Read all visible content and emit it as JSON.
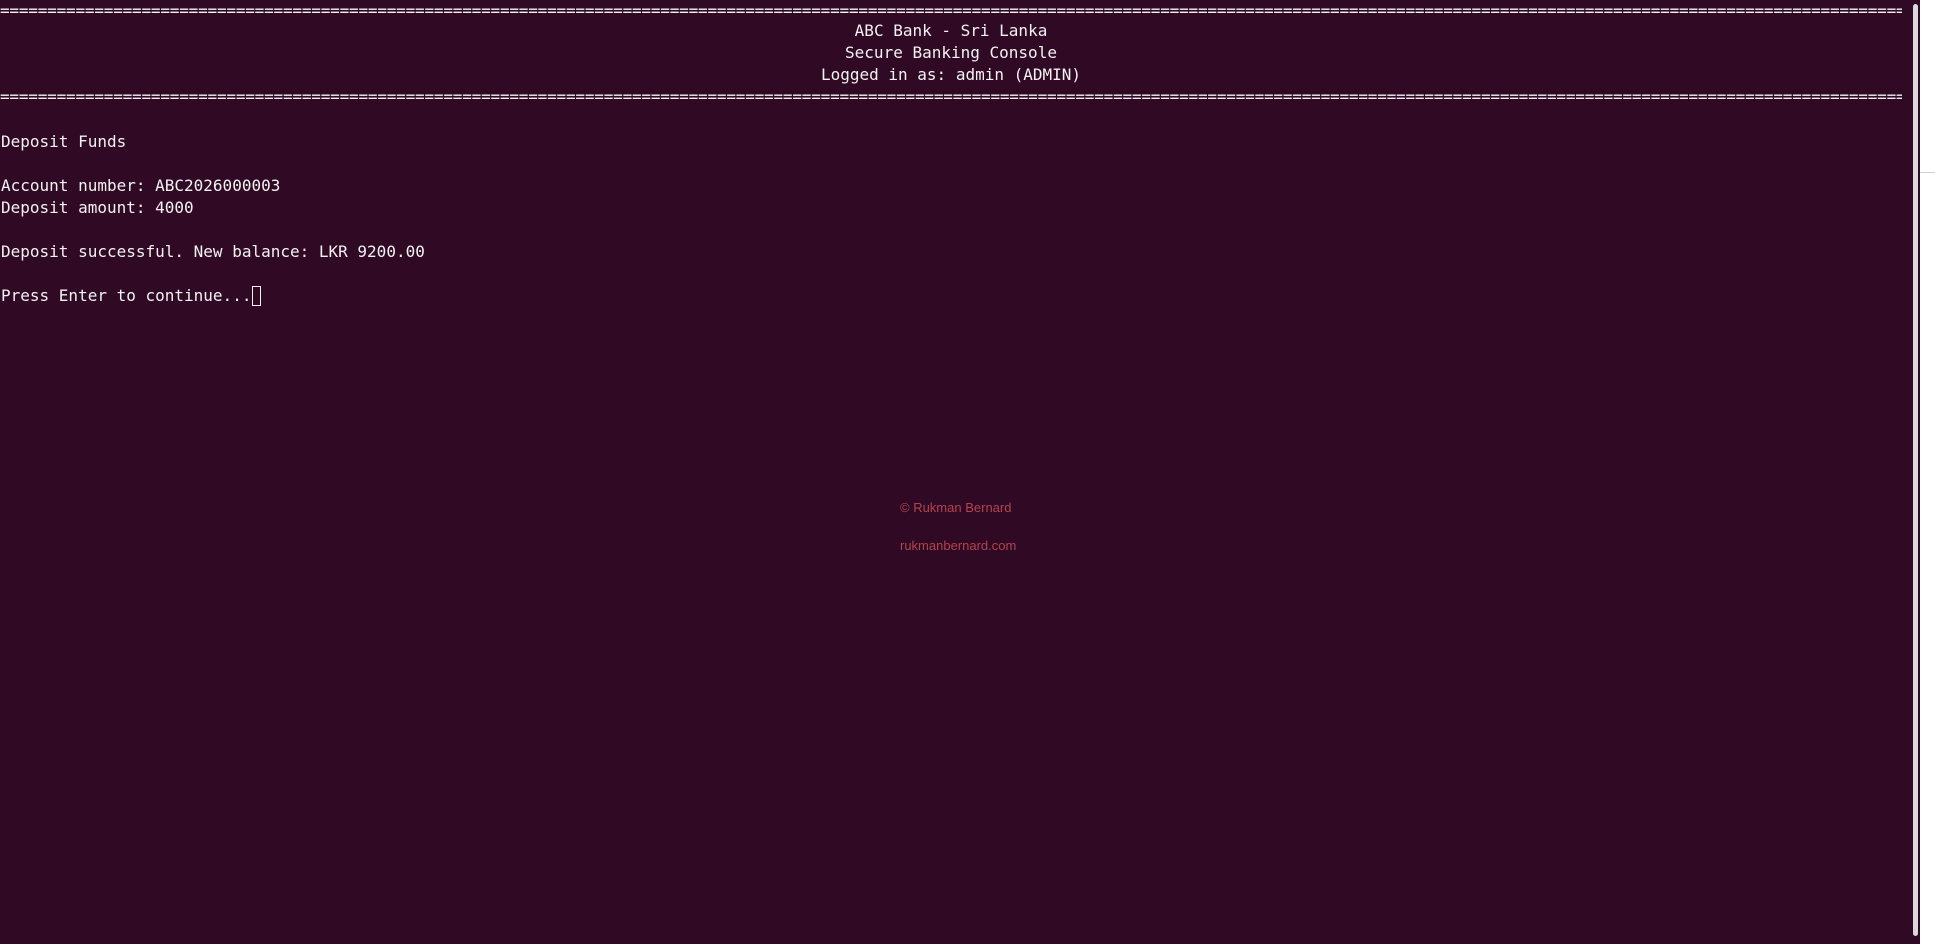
{
  "separator": "==============================================================================================================================================================================================================================",
  "header": {
    "title": "ABC Bank - Sri Lanka",
    "subtitle": "Secure Banking Console",
    "login_status": "Logged in as: admin (ADMIN)"
  },
  "screen": {
    "heading": "Deposit Funds",
    "account_line": "Account number: ABC2026000003",
    "amount_line": "Deposit amount: 4000",
    "result_line": "Deposit successful. New balance: LKR 9200.00",
    "prompt": "Press Enter to continue..."
  },
  "watermark": {
    "copyright": "© Rukman Bernard",
    "website": "rukmanbernard.com"
  },
  "colors": {
    "background": "#300a24",
    "text": "#f2f2f2",
    "watermark": "#b2434f"
  }
}
